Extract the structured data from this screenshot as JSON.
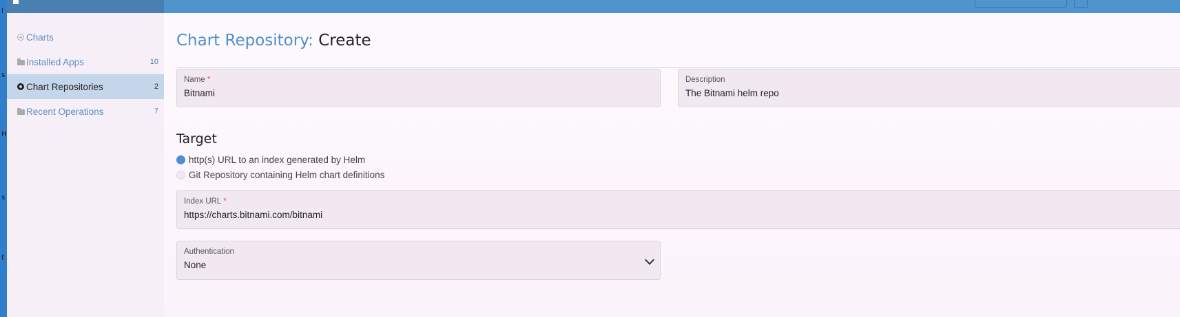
{
  "desktop_strip": [
    "l",
    "s",
    "H",
    "s",
    "f"
  ],
  "sidebar": {
    "items": [
      {
        "label": "Charts",
        "count": "",
        "icon": "circle-plus-icon"
      },
      {
        "label": "Installed Apps",
        "count": "10",
        "icon": "folder-icon"
      },
      {
        "label": "Chart Repositories",
        "count": "2",
        "icon": "gear-icon"
      },
      {
        "label": "Recent Operations",
        "count": "7",
        "icon": "folder-icon"
      }
    ],
    "active_index": 2
  },
  "page": {
    "title_prefix": "Chart Repository:",
    "title_action": "Create"
  },
  "form": {
    "name": {
      "label": "Name",
      "required": "*",
      "value": "Bitnami"
    },
    "description": {
      "label": "Description",
      "value": "The Bitnami helm repo"
    },
    "target": {
      "heading": "Target",
      "options": [
        {
          "label": "http(s) URL to an index generated by Helm",
          "checked": true
        },
        {
          "label": "Git Repository containing Helm chart definitions",
          "checked": false
        }
      ]
    },
    "index_url": {
      "label": "Index URL",
      "required": "*",
      "value": "https://charts.bitnami.com/bitnami"
    },
    "authentication": {
      "label": "Authentication",
      "value": "None"
    }
  },
  "colors": {
    "accent": "#4f8fcf",
    "topbar": "#4f94cd",
    "active_nav": "#c3d6ea",
    "required": "#d9534f"
  }
}
